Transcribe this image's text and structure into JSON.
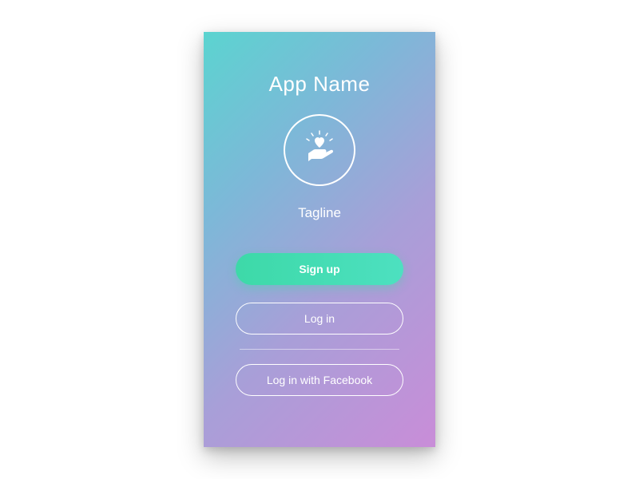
{
  "app": {
    "title": "App Name",
    "tagline": "Tagline",
    "logo_icon": "hand-heart-icon"
  },
  "buttons": {
    "signup": "Sign up",
    "login": "Log in",
    "login_facebook": "Log in with Facebook"
  },
  "colors": {
    "gradient_start": "#5bd4d0",
    "gradient_end": "#c98dd8",
    "primary_button": "#3dd9a8"
  }
}
